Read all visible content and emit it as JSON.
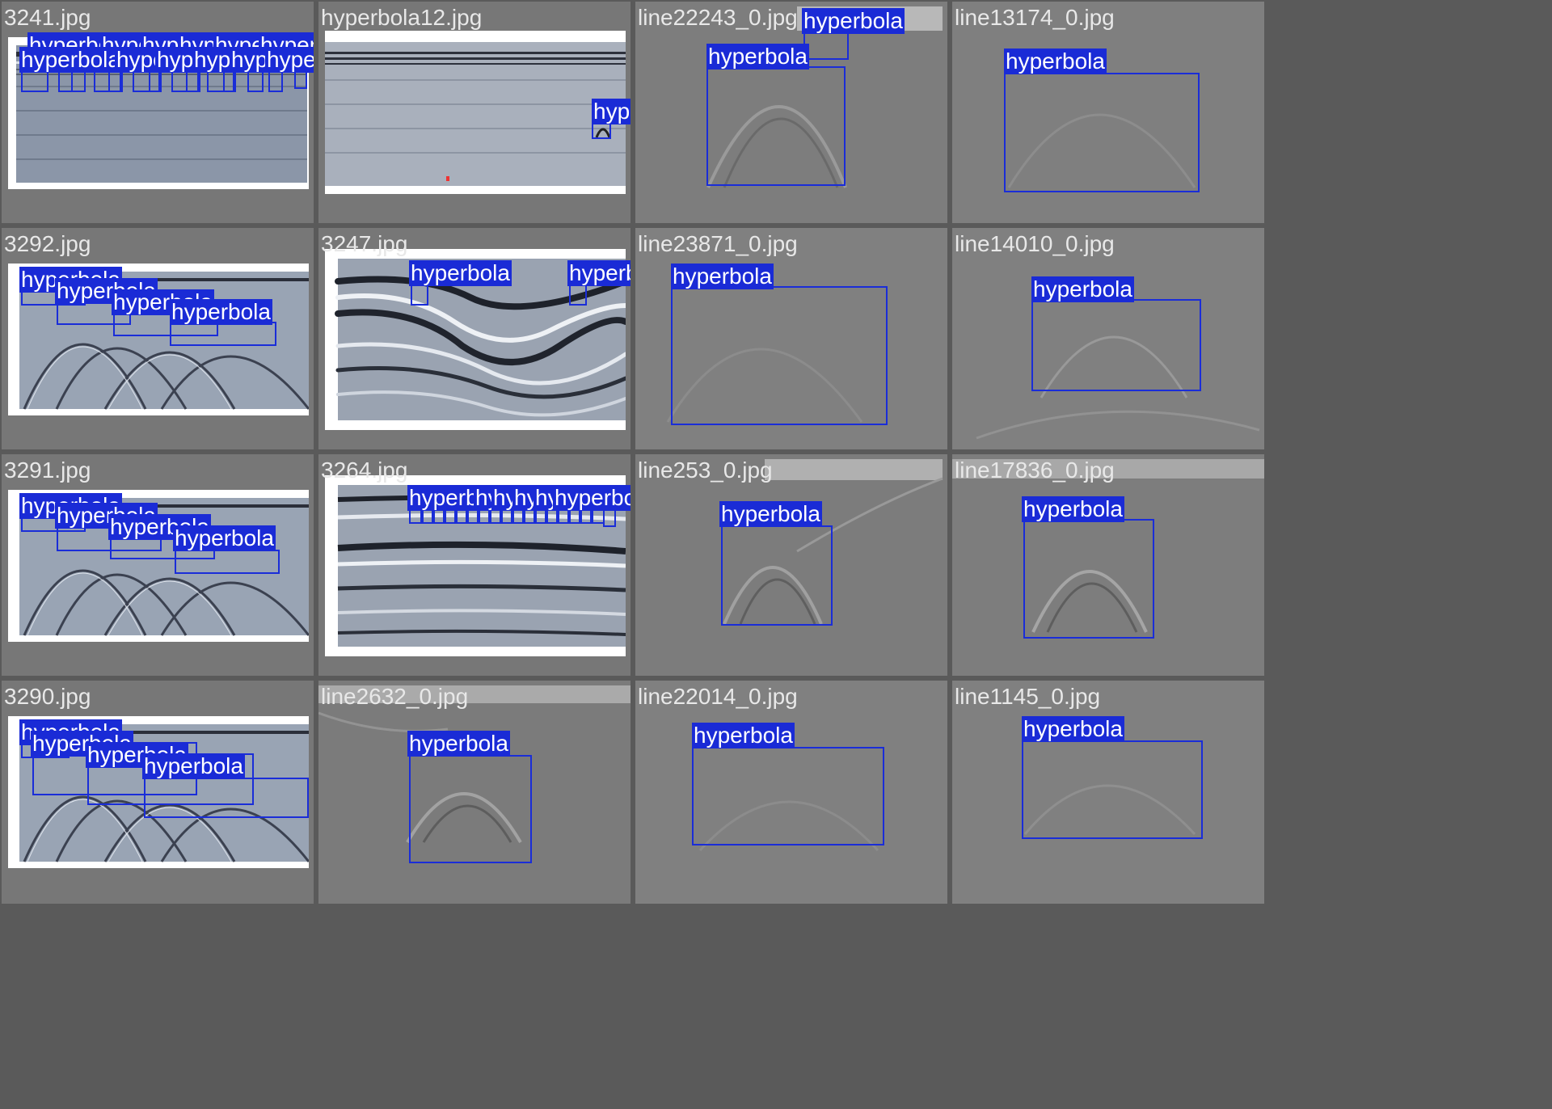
{
  "colors": {
    "box": "#1a2dd8",
    "label_bg": "#1a2bd6",
    "label_text": "#ffffff",
    "title_text": "#e8e8e8"
  },
  "class_name": "hyperbola",
  "tiles": [
    {
      "title": "3241.jpg",
      "kind": "radargram_small",
      "det_count": 16
    },
    {
      "title": "hyperbola12.jpg",
      "kind": "radargram_long",
      "det_count": 1
    },
    {
      "title": "line22243_0.jpg",
      "kind": "gray_patch",
      "det_count": 2
    },
    {
      "title": "line13174_0.jpg",
      "kind": "gray_patch",
      "det_count": 1
    },
    {
      "title": "3292.jpg",
      "kind": "radargram_curves",
      "det_count": 4
    },
    {
      "title": "3247.jpg",
      "kind": "radargram_bands",
      "det_count": 2
    },
    {
      "title": "line23871_0.jpg",
      "kind": "gray_patch",
      "det_count": 1
    },
    {
      "title": "line14010_0.jpg",
      "kind": "gray_patch",
      "det_count": 1
    },
    {
      "title": "3291.jpg",
      "kind": "radargram_curves",
      "det_count": 4
    },
    {
      "title": "3264.jpg",
      "kind": "radargram_bands",
      "det_count": 18
    },
    {
      "title": "line253_0.jpg",
      "kind": "gray_patch",
      "det_count": 1
    },
    {
      "title": "line17836_0.jpg",
      "kind": "gray_patch",
      "det_count": 1
    },
    {
      "title": "3290.jpg",
      "kind": "radargram_curves",
      "det_count": 4
    },
    {
      "title": "line2632_0.jpg",
      "kind": "gray_patch",
      "det_count": 1
    },
    {
      "title": "line22014_0.jpg",
      "kind": "gray_patch",
      "det_count": 1
    },
    {
      "title": "line1145_0.jpg",
      "kind": "gray_patch",
      "det_count": 1
    }
  ]
}
